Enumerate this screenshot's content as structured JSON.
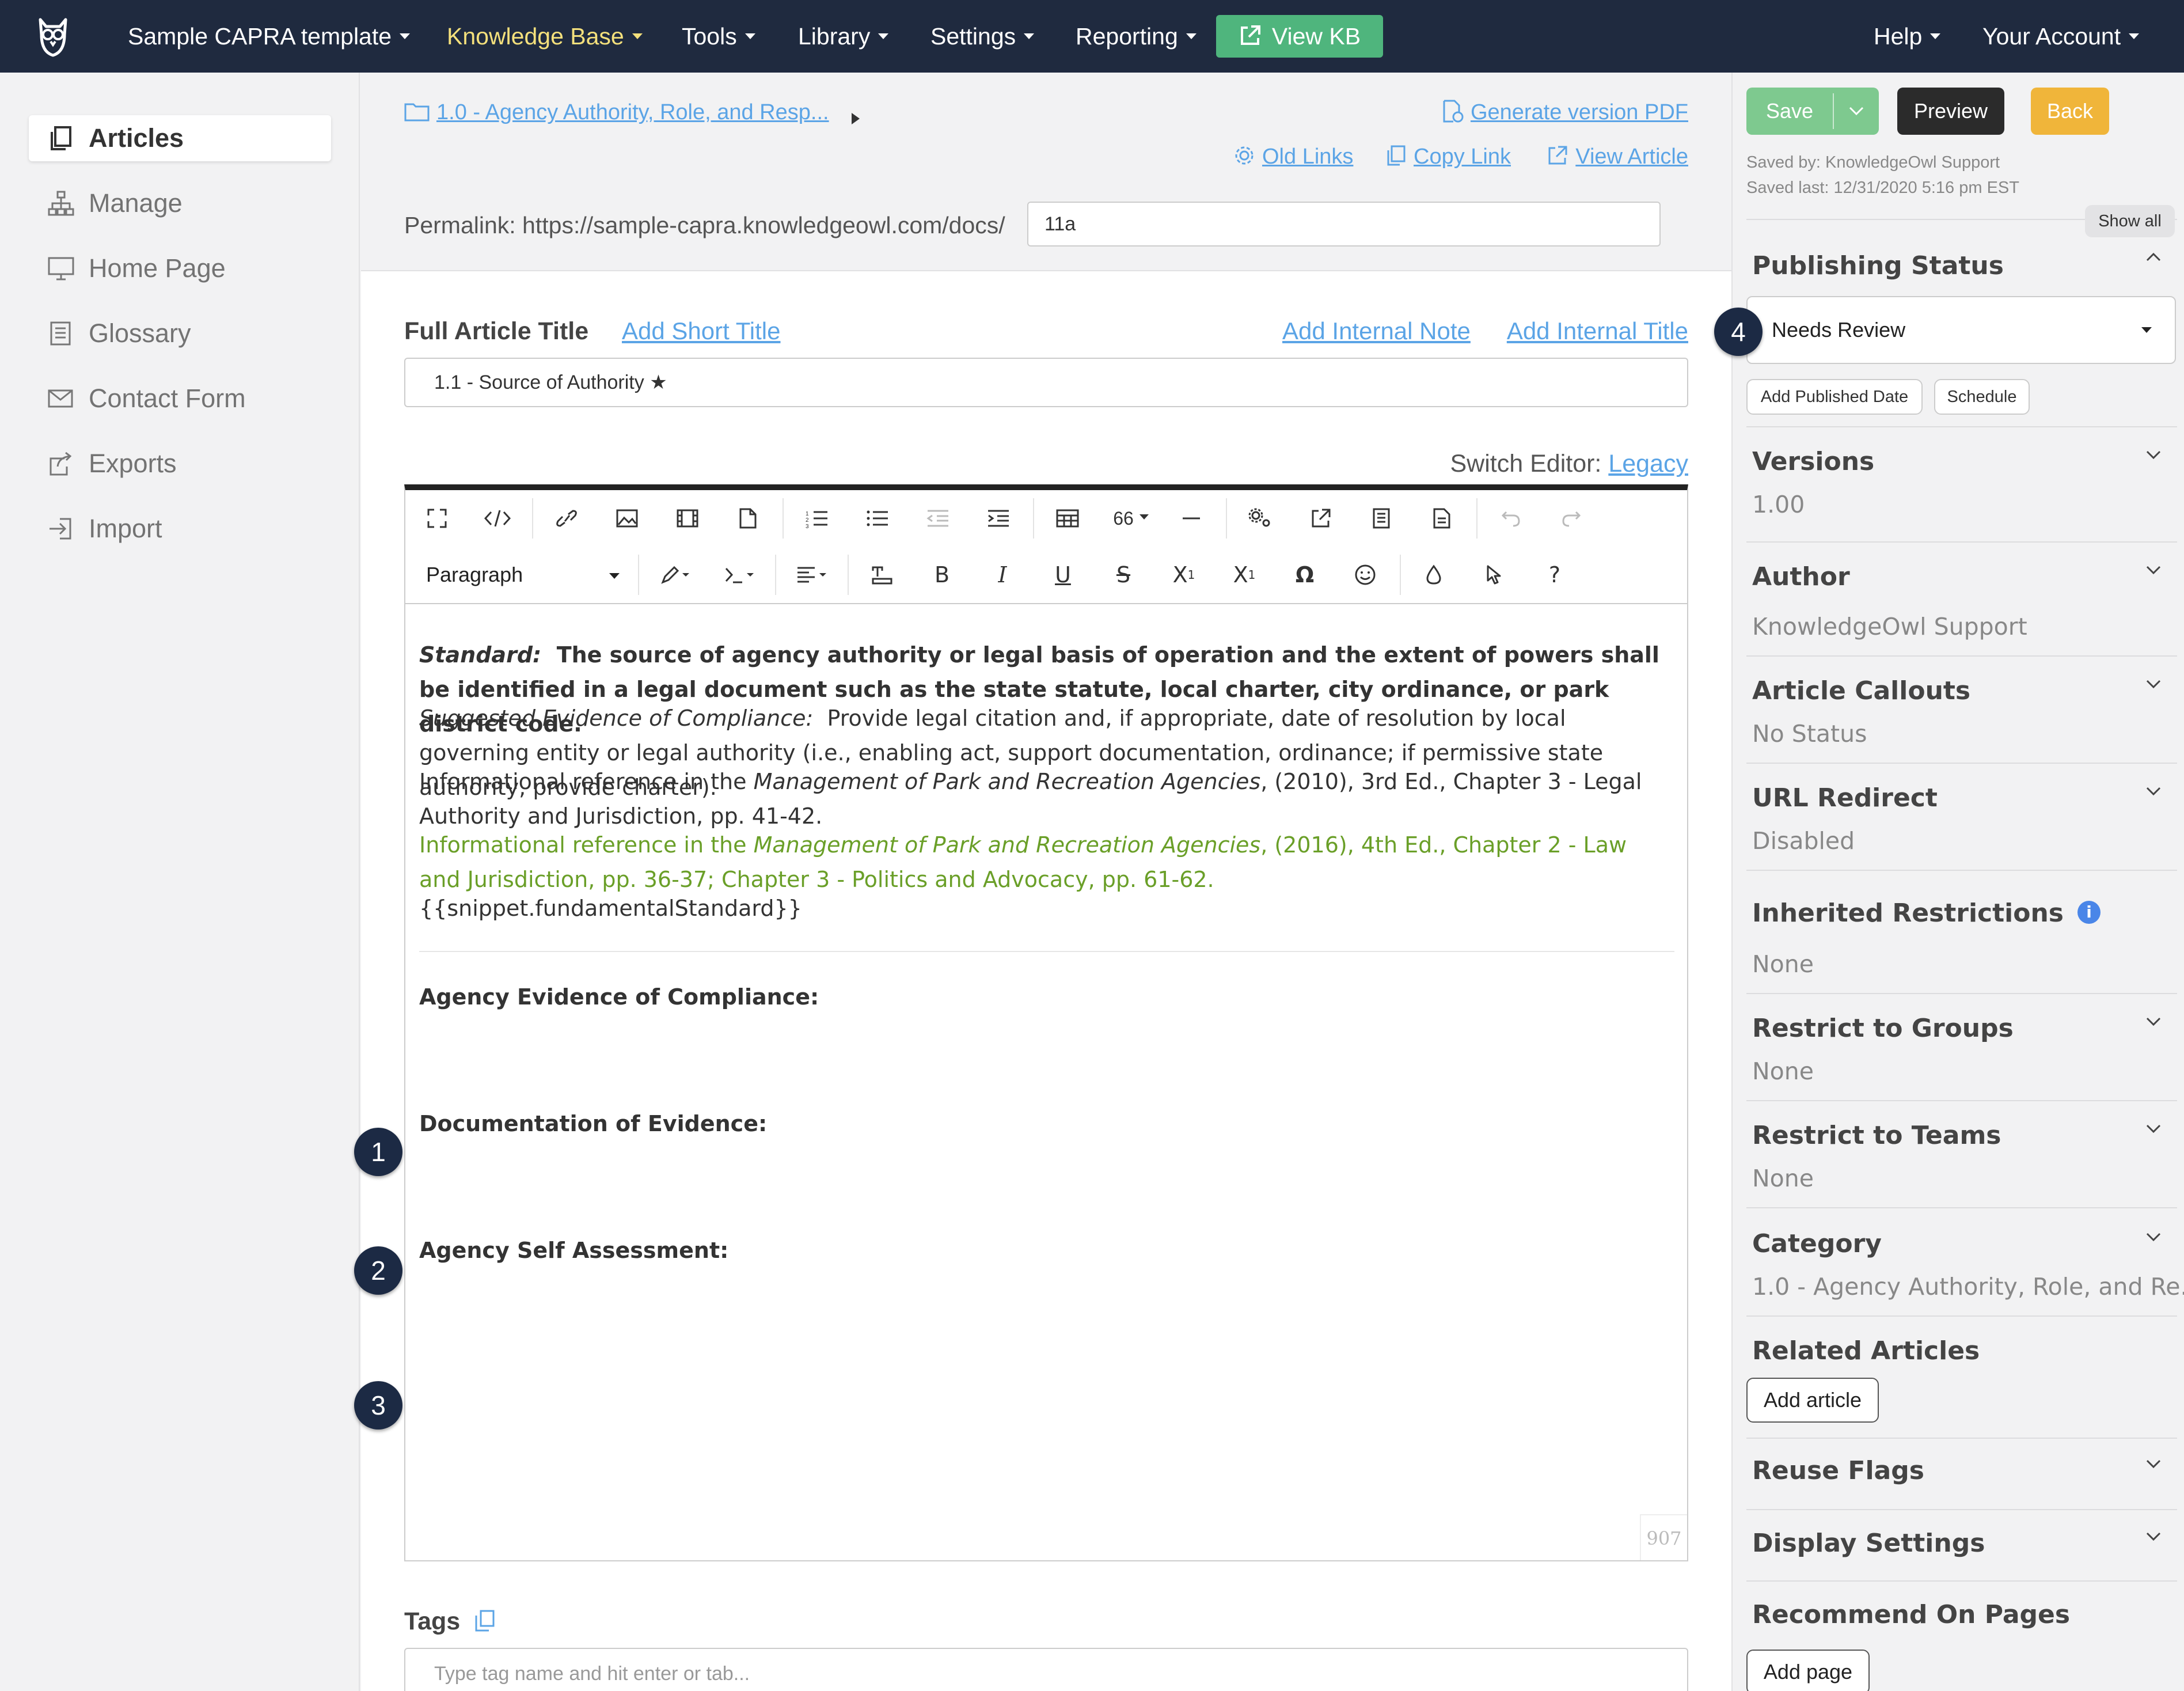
{
  "nav": {
    "items": [
      {
        "label": "Sample CAPRA template",
        "active": false
      },
      {
        "label": "Knowledge Base",
        "active": true
      },
      {
        "label": "Tools",
        "active": false
      },
      {
        "label": "Library",
        "active": false
      },
      {
        "label": "Settings",
        "active": false
      },
      {
        "label": "Reporting",
        "active": false
      }
    ],
    "view_kb": "View KB",
    "help": "Help",
    "account": "Your Account"
  },
  "sidebar": {
    "items": [
      {
        "label": "Articles",
        "icon": "articles-icon"
      },
      {
        "label": "Manage",
        "icon": "sitemap-icon"
      },
      {
        "label": "Home Page",
        "icon": "monitor-icon"
      },
      {
        "label": "Glossary",
        "icon": "book-icon"
      },
      {
        "label": "Contact Form",
        "icon": "envelope-icon"
      },
      {
        "label": "Exports",
        "icon": "export-icon"
      },
      {
        "label": "Import",
        "icon": "import-icon"
      }
    ]
  },
  "header": {
    "breadcrumb": "1.0 - Agency Authority, Role, and Resp...",
    "generate_pdf": "Generate version PDF",
    "old_links": "Old Links",
    "copy_link": "Copy Link",
    "view_article": "View Article",
    "permalink_label": "Permalink: https://sample-capra.knowledgeowl.com/docs/",
    "permalink_value": "11a"
  },
  "article": {
    "full_title_label": "Full Article Title",
    "add_short_title": "Add Short Title",
    "add_internal_note": "Add Internal Note",
    "add_internal_title": "Add Internal Title",
    "title_value": "1.1 - Source of Authority ★",
    "switch_editor_label": "Switch Editor:",
    "switch_editor_link": "Legacy"
  },
  "editor": {
    "paragraph_format": "Paragraph",
    "font_size": "66",
    "word_count": "907",
    "content": {
      "standard_label": "Standard:",
      "standard_text": "The source of agency authority or legal basis of operation and the extent of powers shall be identified in a legal document such as the state statute, local charter, city ordinance, or park district code.",
      "evidence_label": "Suggested Evidence of Compliance:",
      "evidence_text": "Provide legal citation and, if appropriate, date of resolution by local governing entity or legal authority (i.e., enabling act, support documentation, ordinance; if permissive state authority, provide charter).",
      "ref1_prefix": "Informational reference in the ",
      "ref1_title": "Management of Park and Recreation Agencies",
      "ref1_suffix": ", (2010), 3rd Ed., Chapter 3 - Legal Authority and Jurisdiction, pp. 41-42.",
      "ref2_prefix": "Informational reference in the ",
      "ref2_title": "Management of Park and Recreation Agencies",
      "ref2_suffix": ", (2016), 4th Ed., Chapter 2 - Law and Jurisdiction, pp. 36-37; Chapter 3 - Politics and Advocacy, pp. 61-62.",
      "snippet": "{{snippet.fundamentalStandard}}",
      "section1": "Agency Evidence of Compliance:",
      "section2": "Documentation of Evidence:",
      "section3": "Agency Self Assessment:"
    }
  },
  "badges": [
    "1",
    "2",
    "3",
    "4"
  ],
  "tags": {
    "label": "Tags",
    "placeholder": "Type tag name and hit enter or tab..."
  },
  "right": {
    "save": "Save",
    "preview": "Preview",
    "back": "Back",
    "saved_by": "Saved by: KnowledgeOwl Support",
    "saved_last": "Saved last: 12/31/2020 5:16 pm EST",
    "show_all": "Show all",
    "publishing_status": "Publishing Status",
    "status_value": "Needs Review",
    "add_published_date": "Add Published Date",
    "schedule": "Schedule",
    "versions": "Versions",
    "versions_value": "1.00",
    "author": "Author",
    "author_value": "KnowledgeOwl Support",
    "callouts": "Article Callouts",
    "callouts_value": "No Status",
    "url_redirect": "URL Redirect",
    "url_redirect_value": "Disabled",
    "inherited": "Inherited Restrictions",
    "inherited_value": "None",
    "restrict_groups": "Restrict to Groups",
    "restrict_groups_value": "None",
    "restrict_teams": "Restrict to Teams",
    "restrict_teams_value": "None",
    "category": "Category",
    "category_value": "1.0 - Agency Authority, Role, and Re...",
    "related": "Related Articles",
    "add_article": "Add article",
    "reuse_flags": "Reuse Flags",
    "display_settings": "Display Settings",
    "recommend": "Recommend On Pages",
    "add_page": "Add page"
  },
  "colors": {
    "nav_bg": "#1f2a3f",
    "nav_active": "#f4e07c",
    "view_kb": "#4fb57d",
    "save": "#7ec98f",
    "preview": "#2b2b2b",
    "back": "#f0b53a",
    "link": "#5ba4e6",
    "green_text": "#6a9f28"
  }
}
